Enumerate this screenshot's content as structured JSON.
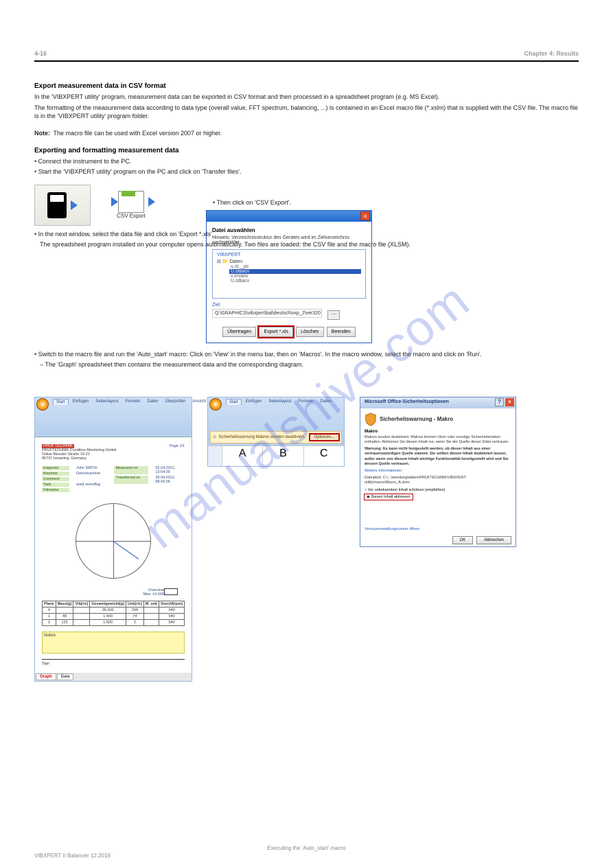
{
  "header": {
    "page": "4-16",
    "title": "Chapter 4: Results"
  },
  "section1": {
    "title": "Export measurement data in CSV format",
    "para1": "In the 'VIBXPERT utility' program, measurement data can be exported in CSV format and then processed in a spreadsheet program (e.g. MS Excel).",
    "para2": "The formatting of the measurement data according to data type (overall value, FFT spectrum, balancing, ...) is contained in an Excel macro file (*.xslm) that is supplied with the CSV file. The macro file is in the 'VIBXPERT utility' program folder.",
    "note_label": "Note:",
    "note_text": "The macro file can be used with Excel version 2007 or higher.",
    "title2": "  Exporting and formatting measurement data",
    "step1a": "• Connect the instrument to the PC.",
    "step1b": "• Start the 'VIBXPERT utility' program on the PC and click on 'Transfer files'.",
    "step2": "• Then click on 'CSV Export'.",
    "step3a": "• In the next window, select the data file and click on 'Export *.xls'.",
    "step3b": "The spreadsheet program installed on your computer opens automatically. Two files are loaded: the CSV file and the macro file (XLSM).",
    "step4": "• Switch to the macro file and run the 'Auto_start' macro: Click on 'View' in the menu bar, then on 'Macros'. In the macro window, select the macro and click on 'Run'.",
    "step5": "– The 'Graph' spreadsheet then contains the measurement data and the corresponding diagram."
  },
  "icons": {
    "csv_label": "CSV Export"
  },
  "dlg": {
    "title": "Datei auswählen",
    "hint": "Hinweis: Verzeichnisstruktur des Gerätes wird im Zielverzeichnis nachgebildet.",
    "tree_label": "VIBXPERT",
    "folder": "Daten",
    "item1": "u.st__pc",
    "item_sel": "U.stbacv",
    "item2": "v.srvaov",
    "item3": "U.stbacv",
    "target_label": "Ziel",
    "target_path": "Q:\\GRAPHICS\\vibxpert\\bal\\deutsch\\vxp_2\\ver320",
    "btn1": "Übertragen",
    "btn2": "Export *.xls",
    "btn3": "Löschen",
    "btn4": "Beenden"
  },
  "excel": {
    "tabs": [
      "Start",
      "Einfügen",
      "Seitenlayout",
      "Formeln",
      "Daten",
      "Überprüfen",
      "Ansicht"
    ],
    "brand": "PRUFTECHNIK",
    "company": "PRUFTECHNIK Condition Monitoring GmbH",
    "addr1": "Oskar-Messter-Straße 19-21",
    "addr2": "85737 Ismaning, Germany",
    "page": "Page 1/1",
    "rows": [
      {
        "k": "Inspector",
        "v": "John SMITH"
      },
      {
        "k": "Machine",
        "v": "Demomachine"
      },
      {
        "k": "Comment",
        "v": ""
      },
      {
        "k": "Task",
        "v": "axial oversflug"
      },
      {
        "k": "Filename",
        "v": ""
      }
    ],
    "rows2": [
      {
        "k": "Measured on",
        "v": "02.04.2012, 13:54:35"
      },
      {
        "k": "Transferred on",
        "v": "28.04.2012, 08:42:06"
      }
    ],
    "overview": "Overview",
    "overview2": "Max: 14.000",
    "cols": [
      "Plane",
      "Mass[g]",
      "Vib[r/s]",
      "Gesamtgewicht[g]",
      "Unk[r/s]",
      "M_unk",
      "Durchf[rpm]"
    ],
    "data": [
      [
        "4",
        "",
        "",
        "36.000",
        "294",
        "",
        "940"
      ],
      [
        "1",
        "48",
        "",
        "1.400",
        "74",
        "",
        "940"
      ],
      [
        "2",
        "125",
        "",
        "1.600",
        "2",
        "",
        "940"
      ]
    ],
    "notes": "Notice",
    "sign": "Sign",
    "tabs2": [
      "Graph",
      "Data"
    ]
  },
  "options": {
    "tabs": [
      "Start",
      "Einfügen",
      "Seitenlayout",
      "Formeln",
      "Daten"
    ],
    "warn": "Sicherheitswarnung   Makros wurden deaktiviert.",
    "btn": "Optionen..."
  },
  "sec": {
    "titlebar": "Microsoft Office-Sicherheitsoptionen",
    "heading": "Sicherheitswarnung - Makro",
    "sub": "Makro",
    "text1": "Makros wurden deaktiviert. Makros können Viren oder sonstige Sicherheitsrisiken enthalten. Aktivieren Sie diesen Inhalt nur, wenn Sie der Quelle dieser Datei vertrauen.",
    "text2": "Warnung: Es kann nicht festgestellt werden, ob dieser Inhalt aus einer vertrauenswürdigen Quelle stammt. Sie sollten diesen Inhalt deaktiviert lassen, außer wenn von diesem Inhalt wichtige Funktionalität bereitgestellt wird und Sie dessen Quelle vertrauen.",
    "more": "Weitere Informationen",
    "path_label": "Dateipfad:",
    "path": "C:\\...\\wendungsdaten\\PRUFTECHNIK\\VIBXPERT utility\\macro\\Macro_A.xlsm",
    "radio1": "Vor unbekanntem Inhalt schützen (empfohlen)",
    "radio2": "Diesen Inhalt aktivieren",
    "trust": "Vertrauensstellungscenter öffnen",
    "ok": "OK",
    "cancel": "Abbrechen"
  },
  "footer": {
    "ref": "VIBXPERT II Balancer 12.2019",
    "caption": "Executing the 'Auto_start' macro"
  },
  "watermark": "manualshive.com"
}
